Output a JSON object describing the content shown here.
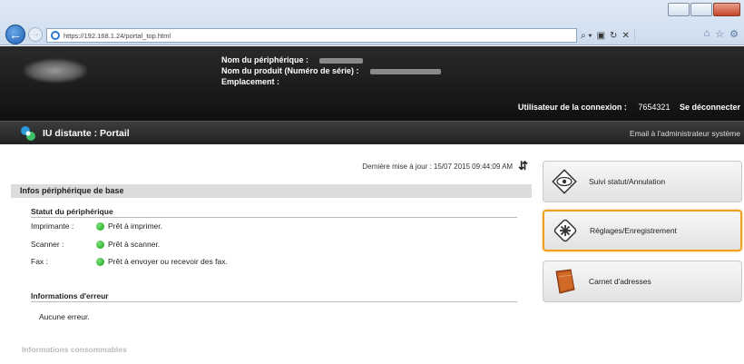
{
  "browser": {
    "url": "https://192.168.1.24/portal_top.html",
    "search_symbol": "⌕ ▾",
    "security_icon": "lock-icon",
    "refresh_symbol": "↻",
    "stop_symbol": "✕"
  },
  "header": {
    "device_name_label": "Nom du périphérique :",
    "product_name_label": "Nom du produit (Numéro de série) :",
    "location_label": "Emplacement :",
    "login_label": "Utilisateur de la connexion :",
    "login_user": "7654321",
    "logout": "Se déconnecter"
  },
  "titlebar": {
    "title": "IU distante : Portail",
    "email_admin": "Email à l'administrateur système"
  },
  "main": {
    "last_update": "Dernière mise à jour : 15/07 2015 09:44:09 AM",
    "basic_info_title": "Infos périphérique de base",
    "device_status_title": "Statut du périphérique",
    "status": [
      {
        "label": "Imprimante :",
        "value": "Prêt à imprimer."
      },
      {
        "label": "Scanner :",
        "value": "Prêt à scanner."
      },
      {
        "label": "Fax :",
        "value": "Prêt à envoyer ou recevoir des fax."
      }
    ],
    "error_title": "Informations d'erreur",
    "error_value": "Aucune erreur.",
    "consumables_title": "Informations consommables"
  },
  "menu": [
    {
      "label": "Suivi statut/Annulation",
      "icon": "eye-icon"
    },
    {
      "label": "Réglages/Enregistrement",
      "icon": "settings-icon"
    },
    {
      "label": "Carnet d'adresses",
      "icon": "address-book-icon"
    }
  ],
  "colors": {
    "active_border": "#f0a020",
    "status_ok": "#16a016",
    "header_bg": "#101010"
  }
}
